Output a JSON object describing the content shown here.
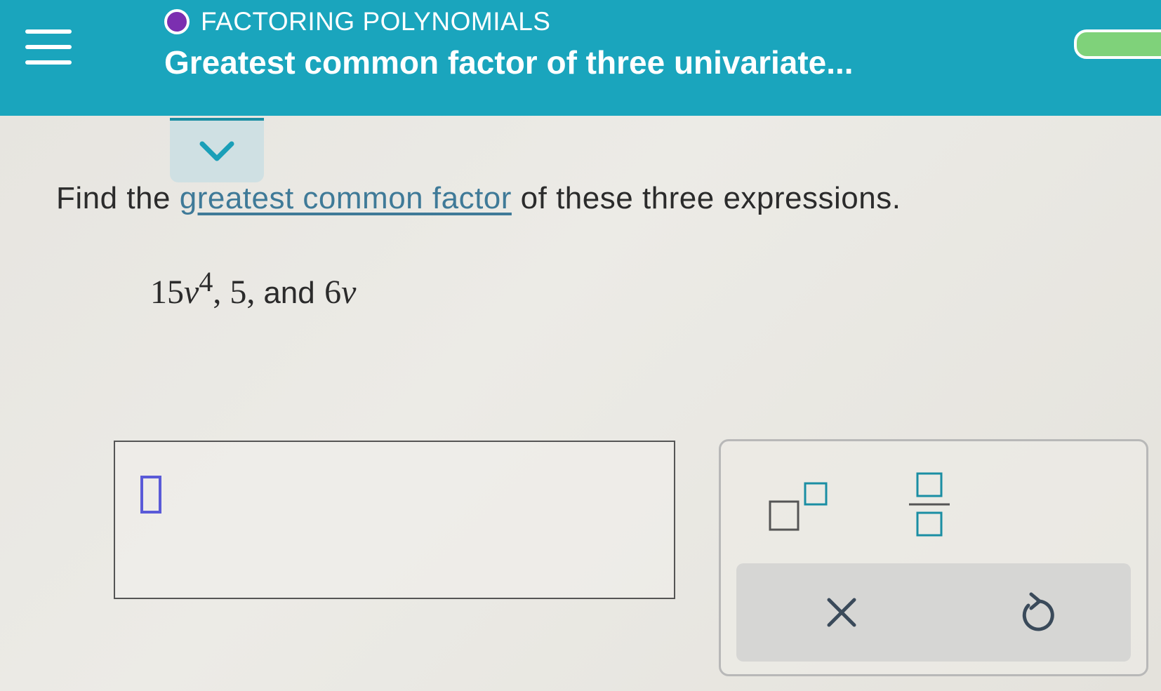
{
  "header": {
    "topic": "FACTORING POLYNOMIALS",
    "title": "Greatest common factor of three univariate..."
  },
  "question": {
    "prefix": "Find the",
    "link_text": "greatest common factor",
    "suffix": "of these three expressions."
  },
  "expression": {
    "term1_coef": "15",
    "term1_var": "v",
    "term1_exp": "4",
    "sep1": ", ",
    "term2": "5",
    "sep2": ", ",
    "and_word": "and",
    "term3_coef": "6",
    "term3_var": "v"
  },
  "answer": {
    "value": ""
  },
  "icons": {
    "menu": "hamburger-menu-icon",
    "collapse": "chevron-down-icon",
    "exponent": "exponent-template-icon",
    "fraction": "fraction-template-icon",
    "clear": "close-x-icon",
    "undo": "undo-icon"
  },
  "colors": {
    "header_bg": "#1aa5bd",
    "topic_dot": "#7b2fb0",
    "link": "#3f7a98",
    "caret": "#5a5ad8",
    "tool_accent": "#1a8ea3",
    "progress": "#7fd27a"
  }
}
